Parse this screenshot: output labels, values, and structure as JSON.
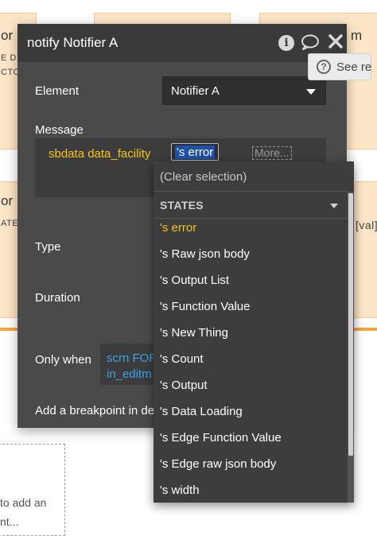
{
  "background": {
    "card_top_left_title": "or",
    "card_top_left_line1": "E D",
    "card_top_left_line2": "CTO",
    "card_top_right_title": "m",
    "card_mid_left_title": "or",
    "card_mid_left_sub": "ATES",
    "card_mid_right_value": "[val]",
    "hint_line1": "to add an",
    "hint_line2": "nt..."
  },
  "modal": {
    "title": "notify Notifier A",
    "element_label": "Element",
    "element_value": "Notifier A",
    "see_reference_label": "See re",
    "message_label": "Message",
    "message_text": "sbdata data_facility",
    "message_chip": "'s error",
    "message_more": "More...",
    "type_label": "Type",
    "duration_label": "Duration",
    "only_when_label": "Only when",
    "only_when_line1": "scrn FOR",
    "only_when_line2": "in_editm",
    "breakpoint_label": "Add a breakpoint in de"
  },
  "dropdown": {
    "clear_label": "(Clear selection)",
    "section_label": "STATES",
    "items": [
      "'s error",
      "'s Raw json body",
      "'s Output List",
      "'s Function Value",
      "'s New Thing",
      "'s Count",
      "'s Output",
      "'s Data Loading",
      "'s Edge Function Value",
      "'s Edge raw json body",
      "'s width"
    ],
    "active_index": 0
  },
  "colors": {
    "modal_bg": "#4a4a4a",
    "modal_header": "#3a3a3a",
    "dynamic_text": "#f5c518",
    "condition_text": "#3ba2e8",
    "selection_bg": "#1f4fa8",
    "canvas_card": "#fde6c8",
    "canvas_strip": "#f7a43a"
  },
  "icons": {
    "info": "info-icon",
    "comment": "speech-bubble-icon",
    "close": "close-icon",
    "see_reference": "question-circle-icon",
    "dropdown_caret": "caret-down-icon"
  }
}
